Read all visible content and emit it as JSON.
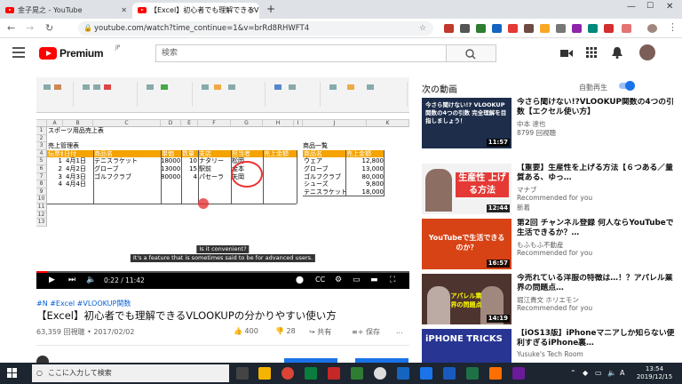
{
  "browser": {
    "tabs": [
      {
        "label": "金子晃之 - YouTube"
      },
      {
        "label": "【Excel】初心者でも理解できるVLOO"
      }
    ],
    "url": "youtube.com/watch?time_continue=1&v=brRd8RHWFT4"
  },
  "youtube": {
    "logo_text": "Premium",
    "logo_region": "JP",
    "search_placeholder": "検索"
  },
  "video": {
    "current_time": "0:22 / 11:42",
    "progress": 0.031,
    "subtitle_top": "Is it convenient?",
    "subtitle_bottom": "It's a feature that is sometimes said to be for advanced users.",
    "tags": "#N #Excel #VLOOKUP関数",
    "title": "【Excel】初心者でも理解できるVLOOKUPの分かりやすい使い方",
    "stats": "63,359 回視聴 • 2017/02/02",
    "likes": "400",
    "dislikes": "28",
    "share_label": "共有",
    "save_label": "保存",
    "more_label": "..."
  },
  "spreadsheet": {
    "columns": [
      "A",
      "B",
      "C",
      "D",
      "E",
      "F",
      "G",
      "H",
      "I",
      "J",
      "K"
    ],
    "rows": [
      "1",
      "2",
      "3",
      "4",
      "5",
      "6",
      "7",
      "8",
      "9",
      "10",
      "11",
      "12",
      "13"
    ],
    "sheet_title": "スポーツ用品売上表",
    "sales_title": "売上管理表",
    "sales_headers": [
      "伝票番号",
      "日付",
      "商品名",
      "単価",
      "数量",
      "支店",
      "担当者",
      "売上金額"
    ],
    "sales_rows": [
      {
        "no": "1",
        "date": "4月1日",
        "item": "テニスラケット",
        "price": "18000",
        "qty": "10",
        "branch": "ナタリー",
        "staff": "松岡"
      },
      {
        "no": "2",
        "date": "4月2日",
        "item": "グローブ",
        "price": "13000",
        "qty": "15",
        "branch": "駅前",
        "staff": "金本"
      },
      {
        "no": "3",
        "date": "4月3日",
        "item": "ゴルフクラブ",
        "price": "80000",
        "qty": "4",
        "branch": "パセーラ",
        "staff": "矢岡"
      },
      {
        "no": "4",
        "date": "4月4日",
        "item": "",
        "price": "",
        "qty": "",
        "branch": "",
        "staff": ""
      }
    ],
    "product_title": "商品一覧",
    "product_headers": [
      "商品名",
      "売上金額"
    ],
    "products": [
      {
        "name": "ウェア",
        "price": "12,800"
      },
      {
        "name": "グローブ",
        "price": "13,000"
      },
      {
        "name": "ゴルフクラブ",
        "price": "80,000"
      },
      {
        "name": "シューズ",
        "price": "9,800"
      },
      {
        "name": "テニスラケット",
        "price": "18,000"
      }
    ]
  },
  "sidebar": {
    "up_next": "次の動画",
    "autoplay_label": "自動再生",
    "autoplay_on": true,
    "cards": [
      {
        "title": "今さら聞けない!?VLOOKUP関数の4つの引数【エクセル使い方】",
        "channel": "中本 達也",
        "meta": "8799 回視聴",
        "duration": "11:57",
        "thumb_text": "今さら聞けない!? VLOOKUP関数の4つの引数 完全理解を目指しましょう！"
      },
      {
        "title": "【重要】生産性を上げる方法【６つある／量質ある、ゆっ…",
        "channel": "マナブ",
        "meta": "Recommended for you",
        "extra": "新着",
        "duration": "12:44",
        "thumb_text": "生産性 上げる方法"
      },
      {
        "title": "第2回 チャンネル登録 何人ならYouTubeで生活できるか？…",
        "channel": "もふもふ不動産",
        "meta": "Recommended for you",
        "duration": "16:57",
        "thumb_text": "YouTubeで生活できるのか？"
      },
      {
        "title": "今売れている洋服の特徴は…！？アパレル業界の問題点…",
        "channel": "堀江貴文 ホリエモン",
        "meta": "Recommended for you",
        "duration": "14:19",
        "thumb_text": "アパレル業界の問題点"
      },
      {
        "title": "【iOS13版】iPhoneマニアしか知らない便利すぎるiPhone裏…",
        "channel": "Yusuke's Tech Room",
        "meta": "",
        "duration": "",
        "thumb_text": "iPHONE TRICKS"
      }
    ]
  },
  "taskbar": {
    "search_placeholder": "ここに入力して検索",
    "time": "13:54",
    "date": "2019/12/15"
  }
}
